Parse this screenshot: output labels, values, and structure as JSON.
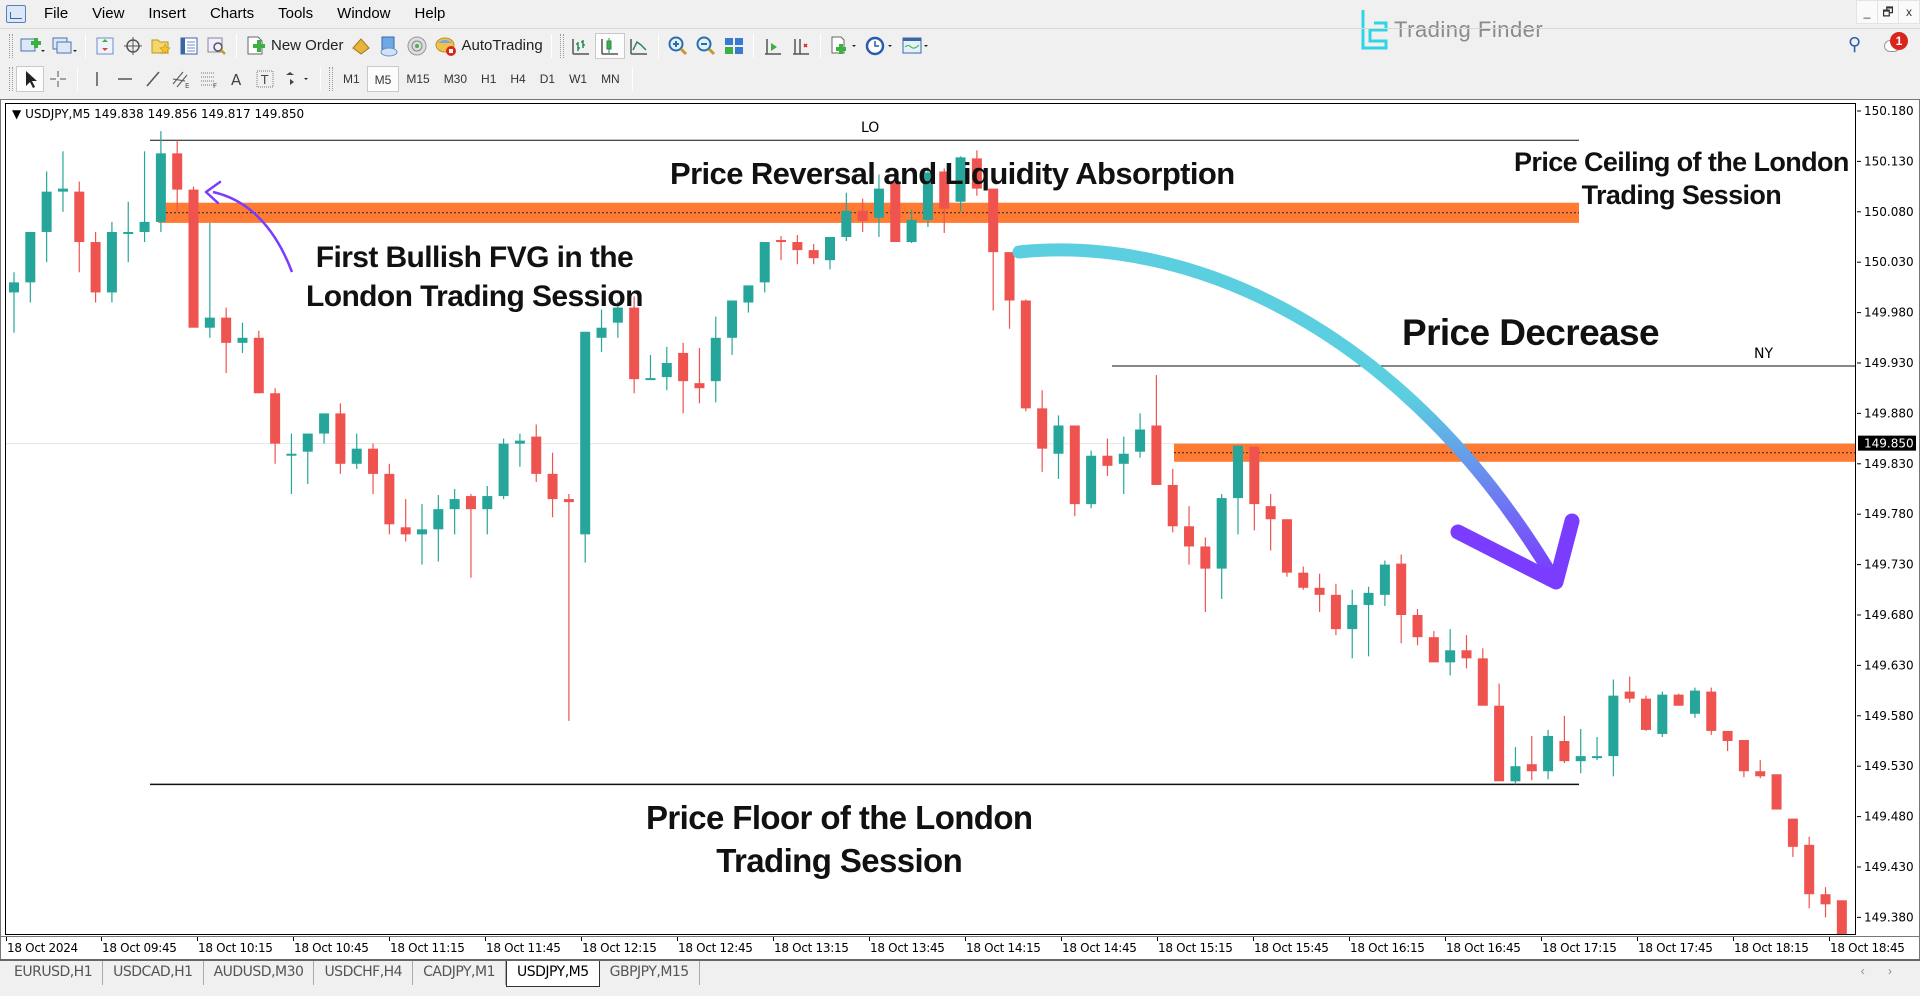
{
  "menubar": {
    "items": [
      "File",
      "View",
      "Insert",
      "Charts",
      "Tools",
      "Window",
      "Help"
    ]
  },
  "brand": {
    "name": "Trading Finder"
  },
  "window_controls": {
    "minimize": "_",
    "restore": "🗗",
    "close": "x"
  },
  "notifications": {
    "count": "1"
  },
  "toolbar": {
    "new_order": "New Order",
    "autotrading": "AutoTrading"
  },
  "timeframes": {
    "items": [
      "M1",
      "M5",
      "M15",
      "M30",
      "H1",
      "H4",
      "D1",
      "W1",
      "MN"
    ],
    "active": "M5"
  },
  "chart": {
    "symbol_info": "USDJPY,M5  149.838 149.856 149.817 149.850",
    "current_price": "149.850",
    "session_labels": {
      "london": "LO",
      "newyork": "NY"
    },
    "annotations": {
      "reversal": "Price Reversal and Liquidity Absorption",
      "ceiling_line1": "Price Ceiling of the London",
      "ceiling_line2": "Trading Session",
      "fvg_line1": "First Bullish FVG in the",
      "fvg_line2": "London Trading Session",
      "decrease": "Price Decrease",
      "floor_line1": "Price Floor of the London",
      "floor_line2": "Trading Session"
    }
  },
  "tabs": [
    {
      "label": "EURUSD,H1",
      "active": false
    },
    {
      "label": "USDCAD,H1",
      "active": false
    },
    {
      "label": "AUDUSD,M30",
      "active": false
    },
    {
      "label": "USDCHF,H4",
      "active": false
    },
    {
      "label": "CADJPY,M1",
      "active": false
    },
    {
      "label": "USDJPY,M5",
      "active": true
    },
    {
      "label": "GBPJPY,M15",
      "active": false
    }
  ],
  "chart_data": {
    "type": "candlestick",
    "symbol": "USDJPY",
    "timeframe": "M5",
    "ylim": [
      149.355,
      150.205
    ],
    "yticks": [
      "150.180",
      "150.130",
      "150.080",
      "150.030",
      "149.980",
      "149.930",
      "149.880",
      "149.830",
      "149.780",
      "149.730",
      "149.680",
      "149.630",
      "149.580",
      "149.530",
      "149.480",
      "149.430",
      "149.380"
    ],
    "xticks": [
      "18 Oct 2024",
      "18 Oct 09:45",
      "18 Oct 10:15",
      "18 Oct 10:45",
      "18 Oct 11:15",
      "18 Oct 11:45",
      "18 Oct 12:15",
      "18 Oct 12:45",
      "18 Oct 13:15",
      "18 Oct 13:45",
      "18 Oct 14:15",
      "18 Oct 14:45",
      "18 Oct 15:15",
      "18 Oct 15:45",
      "18 Oct 16:15",
      "18 Oct 16:45",
      "18 Oct 17:15",
      "18 Oct 17:45",
      "18 Oct 18:15",
      "18 Oct 18:45"
    ],
    "colors": {
      "bull": "#26a69a",
      "bear": "#ef5350",
      "zone": "#ff7a33",
      "arrow_start": "#5bcfe0",
      "arrow_end": "#7a3cff"
    },
    "london_session": {
      "high": 150.151,
      "low": 149.512,
      "label": "LO"
    },
    "newyork_session_line": {
      "price": 149.927,
      "label": "NY"
    },
    "fvg_zones": [
      {
        "name": "london-bullish-fvg",
        "top": 150.089,
        "bottom": 150.069,
        "mid": 150.079
      },
      {
        "name": "ny-fvg",
        "top": 149.85,
        "bottom": 149.832,
        "mid": 149.841
      }
    ],
    "candles": [
      [
        150.0,
        150.02,
        149.96,
        150.01
      ],
      [
        150.01,
        150.05,
        149.99,
        150.06
      ],
      [
        150.06,
        150.12,
        150.03,
        150.1
      ],
      [
        150.1,
        150.14,
        150.08,
        150.103
      ],
      [
        150.1,
        150.11,
        150.02,
        150.05
      ],
      [
        150.05,
        150.06,
        149.99,
        150.0
      ],
      [
        150.0,
        150.07,
        149.99,
        150.06
      ],
      [
        150.058,
        150.09,
        150.03,
        150.06
      ],
      [
        150.06,
        150.14,
        150.05,
        150.07
      ],
      [
        150.07,
        150.16,
        150.06,
        150.138
      ],
      [
        150.138,
        150.151,
        150.08,
        150.102
      ],
      [
        150.102,
        150.105,
        149.97,
        149.965
      ],
      [
        149.965,
        150.069,
        149.955,
        149.975
      ],
      [
        149.975,
        149.985,
        149.92,
        149.95
      ],
      [
        149.95,
        149.97,
        149.94,
        149.955
      ],
      [
        149.955,
        149.962,
        149.9,
        149.9
      ],
      [
        149.9,
        149.905,
        149.83,
        149.85
      ],
      [
        149.84,
        149.86,
        149.8,
        149.84
      ],
      [
        149.842,
        149.86,
        149.81,
        149.86
      ],
      [
        149.86,
        149.88,
        149.85,
        149.88
      ],
      [
        149.88,
        149.89,
        149.82,
        149.83
      ],
      [
        149.83,
        149.86,
        149.825,
        149.845
      ],
      [
        149.845,
        149.85,
        149.8,
        149.82
      ],
      [
        149.82,
        149.83,
        149.76,
        149.77
      ],
      [
        149.767,
        149.795,
        149.753,
        149.76
      ],
      [
        149.76,
        149.79,
        149.73,
        149.765
      ],
      [
        149.765,
        149.799,
        149.733,
        149.785
      ],
      [
        149.785,
        149.805,
        149.76,
        149.795
      ],
      [
        149.798,
        149.8,
        149.717,
        149.785
      ],
      [
        149.785,
        149.808,
        149.76,
        149.798
      ],
      [
        149.798,
        149.855,
        149.795,
        149.85
      ],
      [
        149.85,
        149.86,
        149.827,
        149.853
      ],
      [
        149.857,
        149.869,
        149.812,
        149.82
      ],
      [
        149.82,
        149.841,
        149.777,
        149.795
      ],
      [
        149.795,
        149.8,
        149.575,
        149.792
      ],
      [
        149.76,
        149.958,
        149.732,
        149.961
      ],
      [
        149.955,
        149.983,
        149.941,
        149.965
      ],
      [
        149.97,
        149.991,
        149.955,
        149.985
      ],
      [
        149.985,
        149.996,
        149.9,
        149.914
      ],
      [
        149.915,
        149.938,
        149.914,
        149.915
      ],
      [
        149.916,
        149.946,
        149.903,
        149.93
      ],
      [
        149.94,
        149.95,
        149.88,
        149.912
      ],
      [
        149.91,
        149.945,
        149.89,
        149.905
      ],
      [
        149.912,
        149.976,
        149.891,
        149.955
      ],
      [
        149.955,
        149.986,
        149.938,
        149.992
      ],
      [
        149.99,
        150.0,
        149.98,
        150.007
      ],
      [
        150.01,
        150.047,
        150.0,
        150.05
      ],
      [
        150.052,
        150.056,
        150.032,
        150.05
      ],
      [
        150.05,
        150.057,
        150.028,
        150.042
      ],
      [
        150.042,
        150.048,
        150.028,
        150.034
      ],
      [
        150.032,
        150.049,
        150.023,
        150.055
      ],
      [
        150.055,
        150.099,
        150.051,
        150.081
      ],
      [
        150.081,
        150.093,
        150.06,
        150.071
      ],
      [
        150.074,
        150.117,
        150.055,
        150.103
      ],
      [
        150.11,
        150.11,
        150.055,
        150.05
      ],
      [
        150.05,
        150.082,
        150.049,
        150.072
      ],
      [
        150.072,
        150.124,
        150.065,
        150.119
      ],
      [
        150.12,
        150.123,
        150.059,
        150.083
      ],
      [
        150.09,
        150.135,
        150.08,
        150.134
      ],
      [
        150.133,
        150.141,
        150.096,
        150.103
      ],
      [
        150.103,
        150.095,
        149.982,
        150.04
      ],
      [
        150.04,
        150.007,
        149.964,
        149.992
      ],
      [
        149.992,
        149.993,
        149.882,
        149.885
      ],
      [
        149.885,
        149.903,
        149.822,
        149.845
      ],
      [
        149.84,
        149.878,
        149.815,
        149.868
      ],
      [
        149.868,
        149.867,
        149.778,
        149.79
      ],
      [
        149.79,
        149.843,
        149.786,
        149.838
      ],
      [
        149.838,
        149.855,
        149.818,
        149.828
      ],
      [
        149.83,
        149.857,
        149.8,
        149.84
      ],
      [
        149.842,
        149.88,
        149.836,
        149.864
      ],
      [
        149.868,
        149.918,
        149.839,
        149.809
      ],
      [
        149.809,
        149.825,
        149.762,
        149.768
      ],
      [
        149.768,
        149.788,
        149.73,
        149.748
      ],
      [
        149.748,
        149.757,
        149.683,
        149.726
      ],
      [
        149.726,
        149.8,
        149.696,
        149.796
      ],
      [
        149.796,
        149.847,
        149.76,
        149.848
      ],
      [
        149.847,
        149.844,
        149.764,
        149.79
      ],
      [
        149.788,
        149.8,
        149.744,
        149.775
      ],
      [
        149.775,
        149.775,
        149.718,
        149.722
      ],
      [
        149.722,
        149.728,
        149.705,
        149.707
      ],
      [
        149.707,
        149.721,
        149.683,
        149.7
      ],
      [
        149.7,
        149.711,
        149.66,
        149.666
      ],
      [
        149.666,
        149.705,
        149.637,
        149.69
      ],
      [
        149.69,
        149.708,
        149.639,
        149.702
      ],
      [
        149.7,
        149.734,
        149.689,
        149.73
      ],
      [
        149.731,
        149.74,
        149.652,
        149.68
      ],
      [
        149.68,
        149.686,
        149.65,
        149.658
      ],
      [
        149.658,
        149.664,
        149.638,
        149.633
      ],
      [
        149.633,
        149.666,
        149.62,
        149.645
      ],
      [
        149.645,
        149.66,
        149.627,
        149.637
      ],
      [
        149.637,
        149.647,
        149.592,
        149.59
      ],
      [
        149.59,
        149.612,
        149.527,
        149.515
      ],
      [
        149.515,
        149.549,
        149.512,
        149.53
      ],
      [
        149.532,
        149.56,
        149.516,
        149.525
      ],
      [
        149.525,
        149.566,
        149.517,
        149.56
      ],
      [
        149.555,
        149.58,
        149.533,
        149.535
      ],
      [
        149.535,
        149.567,
        149.523,
        149.54
      ],
      [
        149.538,
        149.559,
        149.536,
        149.54
      ],
      [
        149.54,
        149.616,
        149.52,
        149.6
      ],
      [
        149.604,
        149.619,
        149.593,
        149.597
      ],
      [
        149.597,
        149.6,
        149.565,
        149.566
      ],
      [
        149.562,
        149.604,
        149.559,
        149.601
      ],
      [
        149.601,
        149.602,
        149.59,
        149.59
      ],
      [
        149.582,
        149.608,
        149.578,
        149.605
      ],
      [
        149.604,
        149.608,
        149.561,
        149.565
      ],
      [
        149.565,
        149.559,
        149.545,
        149.555
      ],
      [
        149.556,
        149.548,
        149.519,
        149.525
      ],
      [
        149.525,
        149.536,
        149.518,
        149.52
      ],
      [
        149.522,
        149.519,
        149.488,
        149.487
      ],
      [
        149.478,
        149.477,
        149.44,
        149.45
      ],
      [
        149.452,
        149.46,
        149.389,
        149.403
      ],
      [
        149.403,
        149.41,
        149.38,
        149.393
      ],
      [
        149.397,
        149.39,
        149.346,
        149.35
      ]
    ]
  }
}
